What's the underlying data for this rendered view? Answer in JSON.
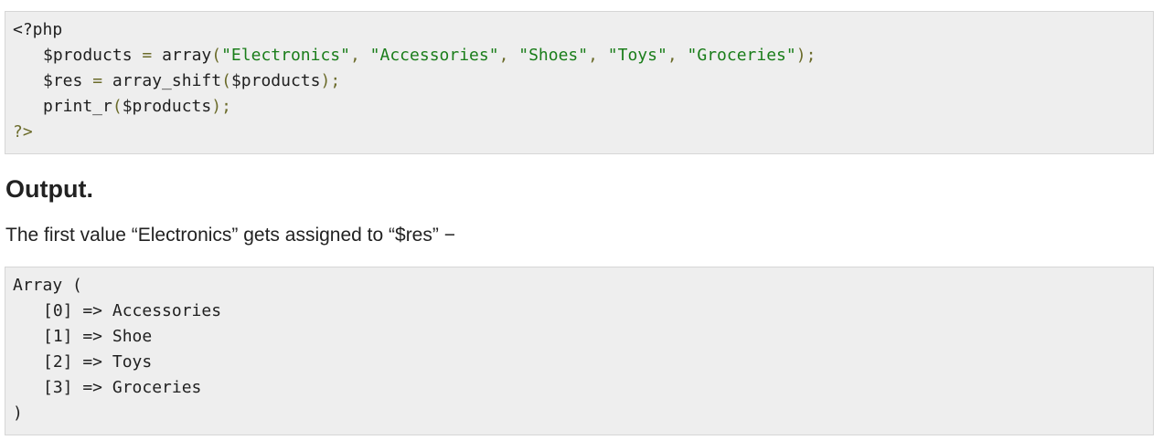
{
  "code_example": {
    "open_tag": "<?php",
    "line1": {
      "var": "$products",
      "assign": " = ",
      "func": "array",
      "open_paren": "(",
      "items": [
        "\"Electronics\"",
        "\"Accessories\"",
        "\"Shoes\"",
        "\"Toys\"",
        "\"Groceries\""
      ],
      "sep": ", ",
      "close": ");"
    },
    "line2": {
      "var": "$res",
      "assign": " = ",
      "func": "array_shift",
      "open_paren": "(",
      "arg": "$products",
      "close": ");"
    },
    "line3": {
      "func": "print_r",
      "open_paren": "(",
      "arg": "$products",
      "close": ");"
    },
    "close_tag": "?>"
  },
  "output_heading": "Output.",
  "output_description": "The first value “Electronics” gets assigned to “$res” −",
  "output_block": {
    "open": "Array (",
    "entries": [
      "[0] => Accessories",
      "[1] => Shoe",
      "[2] => Toys",
      "[3] => Groceries"
    ],
    "close": ")"
  },
  "colors": {
    "code_background": "#eeeeee",
    "string_color": "#1a7d1a",
    "punctuation_color": "#6b6b2a",
    "text_color": "#222222"
  }
}
